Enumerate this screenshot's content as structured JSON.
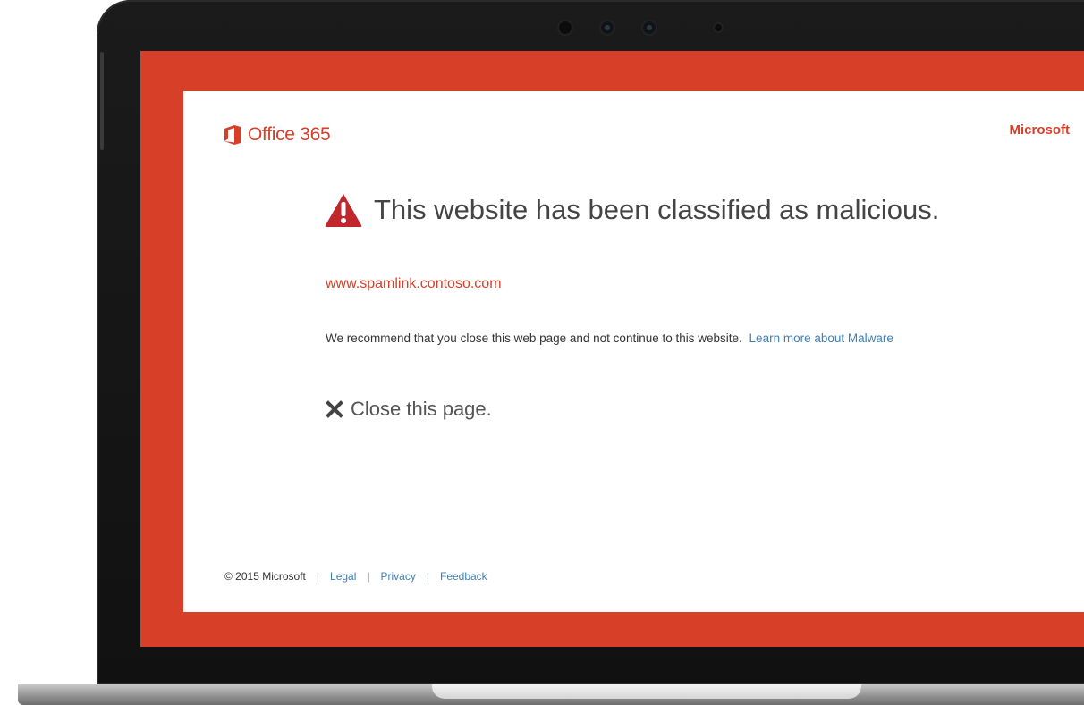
{
  "brand": {
    "product_name": "Office 365",
    "company": "Microsoft",
    "logo_icon": "office-logo-icon",
    "accent_color": "#d73f29"
  },
  "warning": {
    "headline": "This website has been classified as malicious.",
    "icon": "warning-triangle-icon",
    "icon_color": "#c0272d",
    "url": "www.spamlink.contoso.com",
    "recommendation": "We recommend that you close this web page and not continue to this website.",
    "learn_more_link": "Learn more about Malware",
    "link_color": "#3f7fb5"
  },
  "actions": {
    "close_label": "Close this page.",
    "close_icon": "close-x-icon"
  },
  "footer": {
    "copyright": "© 2015 Microsoft",
    "separator": "|",
    "links": [
      "Legal",
      "Privacy",
      "Feedback"
    ]
  }
}
